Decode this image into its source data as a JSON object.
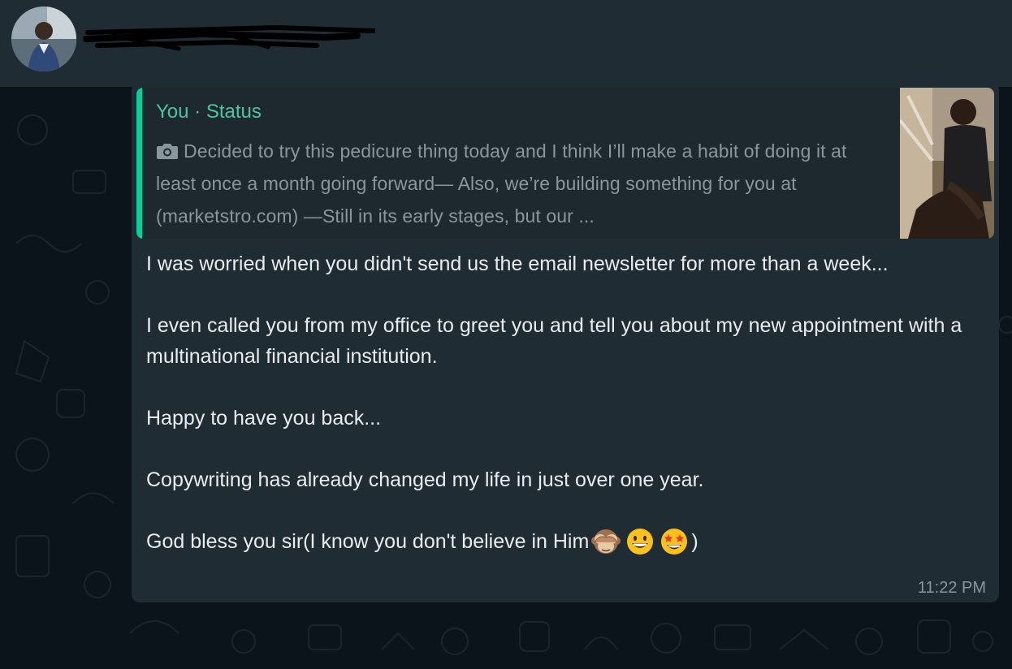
{
  "header": {
    "contact_name_redacted": true
  },
  "quoted_status": {
    "author": "You · Status",
    "media_icon": "camera-icon",
    "text": "Decided to try this pedicure thing today and I think I’ll make a habit of doing it at least once a month going forward— Also, we’re building something for you at (marketstro.com) —Still in its early stages, but our ..."
  },
  "message": {
    "paragraphs": [
      "I was worried when you didn't send us the email newsletter for more than a week...",
      "I even called you from my office to greet you and tell you about my new appointment with a multinational financial institution.",
      "Happy to have you back...",
      "Copywriting has already changed my life in just over one year."
    ],
    "last_line_prefix": "God bless you sir(I know you don't believe in Him",
    "last_line_suffix": ")",
    "emojis": [
      "see-no-evil-monkey-emoji",
      "grinning-face-emoji",
      "star-struck-emoji"
    ],
    "time": "11:22 PM"
  },
  "colors": {
    "accent": "#06cf9c",
    "author_name": "#4fc4a0",
    "bubble": "#202c33",
    "header": "#202c33",
    "background": "#0b141a"
  }
}
